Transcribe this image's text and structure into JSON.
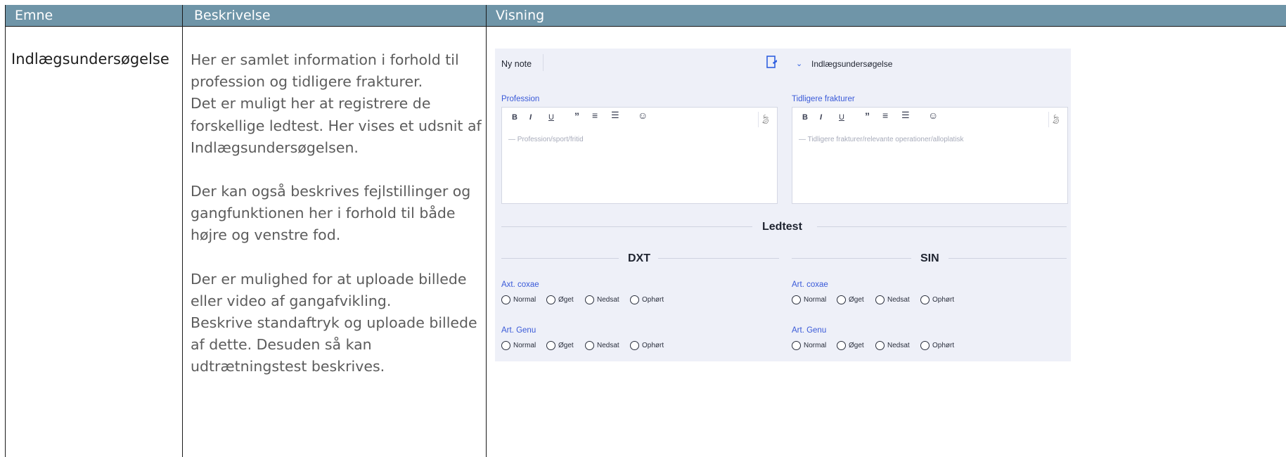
{
  "table": {
    "headers": [
      "Emne",
      "Beskrivelse",
      "Visning"
    ],
    "topic": "Indlægsundersøgelse",
    "description": [
      "Her er samlet information i forhold til",
      "profession og tidligere frakturer.",
      "Det er muligt her at registrere de",
      "forskellige ledtest. Her vises et udsnit af",
      "Indlægsundersøgelsen.",
      "",
      "Der kan også beskrives fejlstillinger og",
      "gangfunktionen her i forhold til både",
      "højre og venstre fod.",
      "",
      "Der er mulighed for at uploade billede",
      "eller video af gangafvikling.",
      "Beskrive standaftryk og uploade billede",
      "af dette. Desuden så kan",
      "udtrætningstest beskrives."
    ]
  },
  "app": {
    "title": "Ny note",
    "selected_template": "Indlægsundersøgelse",
    "toolbar": [
      "B",
      "I",
      "U",
      "”",
      "≡",
      "☰",
      "☺"
    ],
    "fields": [
      {
        "label": "Profession",
        "placeholder": "— Profession/sport/fritid"
      },
      {
        "label": "Tidligere frakturer",
        "placeholder": "— Tidligere frakturer/relevante operationer/alloplatisk"
      }
    ],
    "section": "Ledtest",
    "sides": [
      {
        "title": "DXT",
        "groups": [
          {
            "label": "Axt. coxae",
            "options": [
              "Normal",
              "Øget",
              "Nedsat",
              "Ophørt"
            ]
          },
          {
            "label": "Art. Genu",
            "options": [
              "Normal",
              "Øget",
              "Nedsat",
              "Ophørt"
            ]
          }
        ]
      },
      {
        "title": "SIN",
        "groups": [
          {
            "label": "Art. coxae",
            "options": [
              "Normal",
              "Øget",
              "Nedsat",
              "Ophørt"
            ]
          },
          {
            "label": "Art. Genu",
            "options": [
              "Normal",
              "Øget",
              "Nedsat",
              "Ophørt"
            ]
          }
        ]
      }
    ]
  },
  "colors": {
    "header_bg": "#6f95a8",
    "accent": "#3a5ad8",
    "panel_bg": "#eef0f8"
  }
}
